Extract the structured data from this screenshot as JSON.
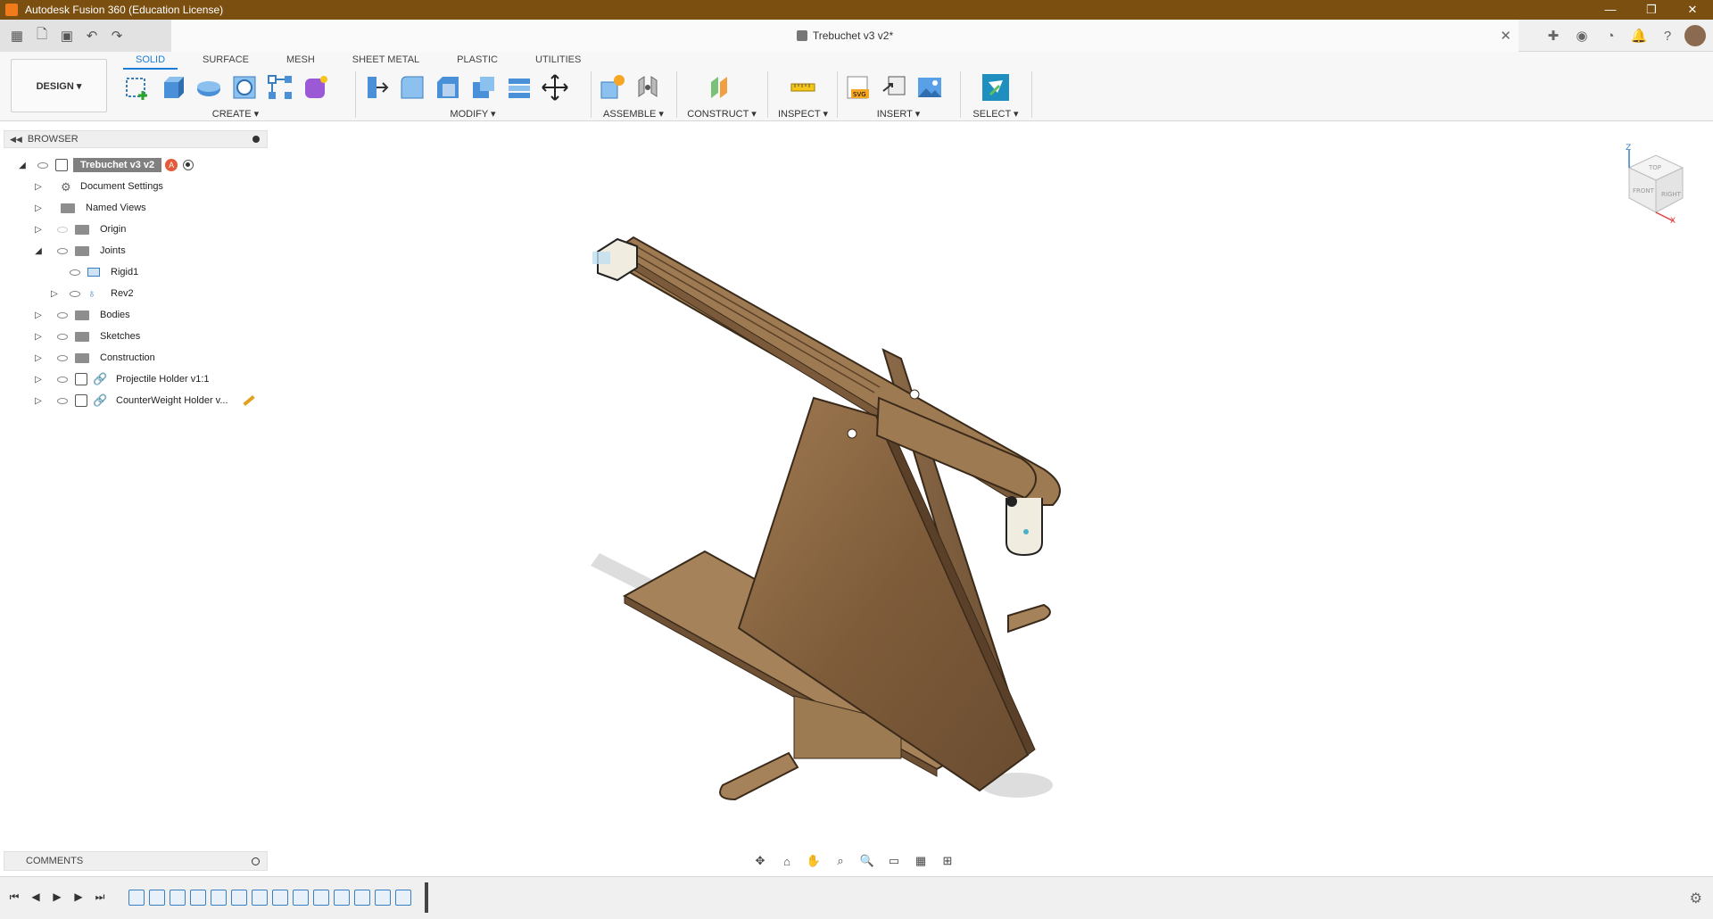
{
  "window": {
    "title": "Autodesk Fusion 360 (Education License)",
    "controls": [
      "—",
      "❐",
      "✕"
    ]
  },
  "document": {
    "name": "Trebuchet v3 v2*"
  },
  "workspace": {
    "label": "DESIGN ▾"
  },
  "ribbon_tabs": [
    {
      "label": "SOLID",
      "active": true
    },
    {
      "label": "SURFACE"
    },
    {
      "label": "MESH"
    },
    {
      "label": "SHEET METAL"
    },
    {
      "label": "PLASTIC"
    },
    {
      "label": "UTILITIES"
    }
  ],
  "groups": {
    "create": "CREATE ▾",
    "modify": "MODIFY ▾",
    "assemble": "ASSEMBLE ▾",
    "construct": "CONSTRUCT ▾",
    "inspect": "INSPECT ▾",
    "insert": "INSERT ▾",
    "select": "SELECT ▾"
  },
  "browser": {
    "title": "BROWSER",
    "root": "Trebuchet v3 v2",
    "root_badge": "A",
    "items": [
      {
        "label": "Document Settings"
      },
      {
        "label": "Named Views"
      },
      {
        "label": "Origin"
      },
      {
        "label": "Joints"
      },
      {
        "label": "Rigid1"
      },
      {
        "label": "Rev2"
      },
      {
        "label": "Bodies"
      },
      {
        "label": "Sketches"
      },
      {
        "label": "Construction"
      },
      {
        "label": "Projectile Holder v1:1"
      },
      {
        "label": "CounterWeight Holder v..."
      }
    ]
  },
  "viewcube": {
    "top": "TOP",
    "front": "FRONT",
    "right": "RIGHT",
    "z": "Z",
    "x": "X"
  },
  "comments": {
    "title": "COMMENTS"
  },
  "colors": {
    "titlebar": "#7a4f10",
    "accent": "#1a7cd6",
    "wood": "#8b6a45"
  }
}
